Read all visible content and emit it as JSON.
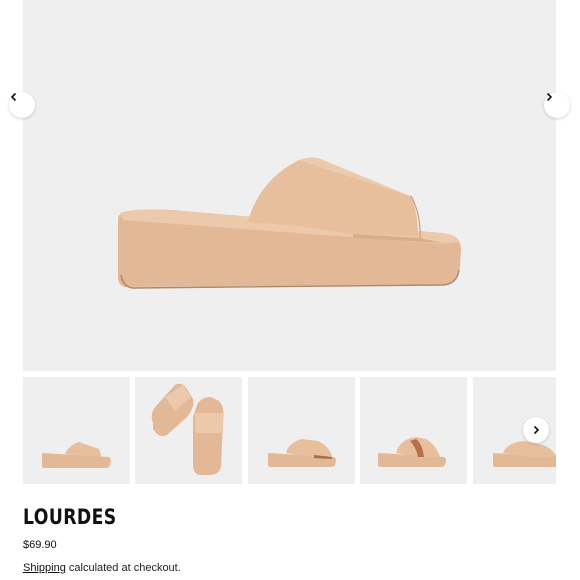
{
  "product": {
    "title": "LOURDES",
    "price": "$69.90",
    "shipping_link": "Shipping",
    "shipping_note": " calculated at checkout."
  },
  "gallery": {
    "main_image": "beige-platform-slide-sandal",
    "thumbnails": [
      "sandal-side-view",
      "sandal-pair-top-view",
      "sandal-side-view-2",
      "sandal-back-view",
      "sandal-side-view-partial"
    ],
    "prev_icon": "chevron-left-icon",
    "next_icon": "chevron-right-icon"
  },
  "colors": {
    "background": "#efefef",
    "sandal": "#e3bb9a",
    "sandal_shade": "#d3a886",
    "sole_edge": "#a98a6c"
  }
}
